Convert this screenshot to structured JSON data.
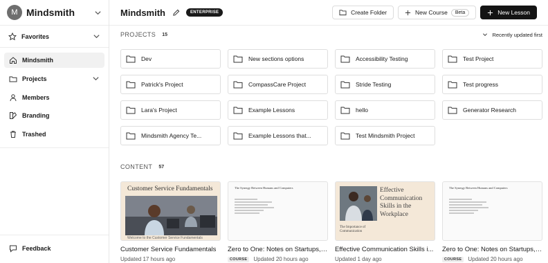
{
  "sidebar": {
    "workspace": {
      "initial": "M",
      "name": "Mindsmith"
    },
    "favorites_label": "Favorites",
    "items": [
      {
        "label": "Mindsmith",
        "icon": "home-icon"
      },
      {
        "label": "Projects",
        "icon": "folder-icon"
      },
      {
        "label": "Members",
        "icon": "person-icon"
      },
      {
        "label": "Branding",
        "icon": "paint-icon"
      },
      {
        "label": "Trashed",
        "icon": "trash-icon"
      }
    ],
    "feedback_label": "Feedback"
  },
  "header": {
    "title": "Mindsmith",
    "badge": "ENTERPRISE",
    "create_folder_label": "Create Folder",
    "new_course_label": "New Course",
    "beta_label": "Beta",
    "new_lesson_label": "New Lesson"
  },
  "projects": {
    "title": "PROJECTS",
    "count": "15",
    "sort_label": "Recently updated first",
    "folders": [
      "Dev",
      "New sections options",
      "Accessibility Testing",
      "Test Project",
      "Patrick's Project",
      "CompassCare Project",
      "Stride Testing",
      "Test progress",
      "Lara's Project",
      "Example Lessons",
      "hello",
      "Generator Research",
      "Mindsmith Agency Te...",
      "Example Lessons that...",
      "Test Mindsmith Project"
    ]
  },
  "content": {
    "title": "CONTENT",
    "count": "57",
    "cards": [
      {
        "title": "Customer Service Fundamentals",
        "tag": "",
        "updated": "Updated 17 hours ago",
        "thumb_title": "Customer Service Fundamentals",
        "thumb_caption": "Welcome to the Customer Service Fundamentals"
      },
      {
        "title": "Zero to One: Notes on Startups, ...",
        "tag": "COURSE",
        "updated": "Updated 20 hours ago",
        "thumb_title": "The Synergy Between Humans and Computers"
      },
      {
        "title": "Effective Communication Skills i...",
        "tag": "",
        "updated": "Updated 1 day ago",
        "thumb_title": "Effective Communication Skills in the Workplace",
        "thumb_sub": "The Importance of Communication"
      },
      {
        "title": "Zero to One: Notes on Startups, ...",
        "tag": "COURSE",
        "updated": "Updated 20 hours ago",
        "thumb_title": "The Synergy Between Humans and Computers"
      }
    ]
  },
  "colors": {
    "dark": "#141414",
    "border": "#dedede",
    "thumb_beige": "#f4e8d8"
  }
}
